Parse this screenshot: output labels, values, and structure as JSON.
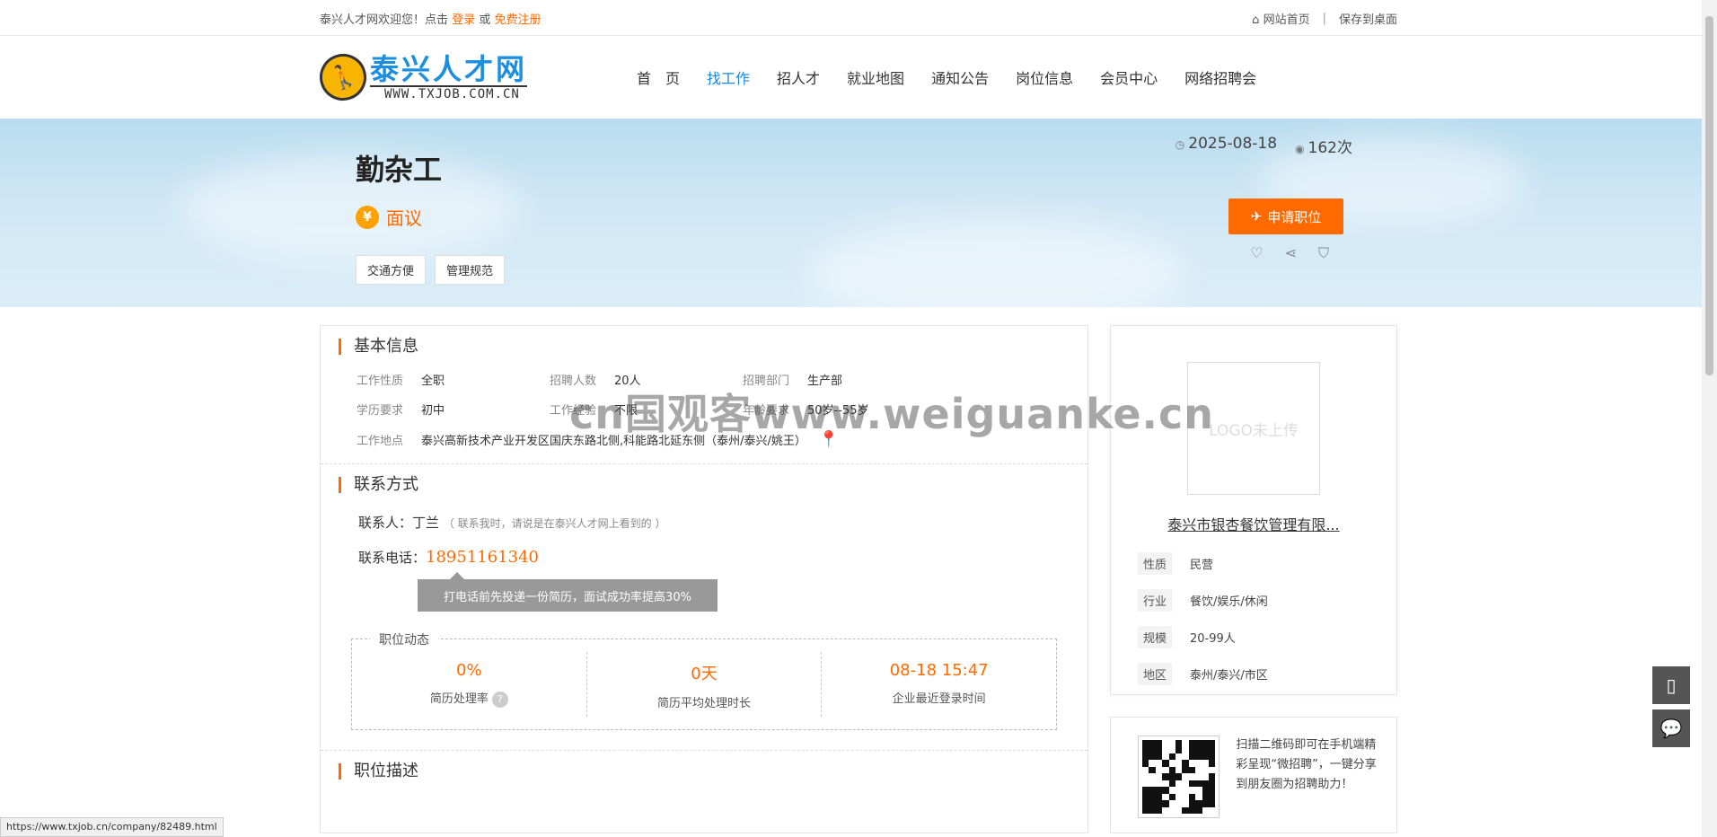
{
  "topbar": {
    "welcome": "泰兴人才网欢迎您！点击",
    "login": "登录",
    "or": "或",
    "register": "免费注册",
    "home": "网站首页",
    "separator": "|",
    "save_desktop": "保存到桌面"
  },
  "logo": {
    "title": "泰兴人才网",
    "url": "WWW.TXJOB.COM.CN"
  },
  "nav": [
    {
      "label": "首　页"
    },
    {
      "label": "找工作"
    },
    {
      "label": "招人才"
    },
    {
      "label": "就业地图"
    },
    {
      "label": "通知公告"
    },
    {
      "label": "岗位信息"
    },
    {
      "label": "会员中心"
    },
    {
      "label": "网络招聘会"
    }
  ],
  "job": {
    "title": "勤杂工",
    "salary_icon": "¥",
    "salary": "面议",
    "tags": [
      "交通方便",
      "管理规范"
    ],
    "date": "2025-08-18",
    "views": "162次",
    "apply": "申请职位"
  },
  "basic": {
    "title": "基本信息",
    "rows": [
      [
        {
          "label": "工作性质",
          "value": "全职"
        },
        {
          "label": "招聘人数",
          "value": "20人"
        },
        {
          "label": "招聘部门",
          "value": "生产部"
        }
      ],
      [
        {
          "label": "学历要求",
          "value": "初中"
        },
        {
          "label": "工作经验",
          "value": "不限"
        },
        {
          "label": "年龄要求",
          "value": "50岁--55岁"
        }
      ]
    ],
    "addr_label": "工作地点",
    "addr": "泰兴高新技术产业开发区国庆东路北侧,科能路北延东侧（泰州/泰兴/姚王）"
  },
  "contact": {
    "title": "联系方式",
    "person_label": "联系人：",
    "person": "丁兰",
    "hint": "（ 联系我时，请说是在泰兴人才网上看到的 ）",
    "phone_label": "联系电话：",
    "phone": "18951161340",
    "tooltip": "打电话前先投递一份简历，面试成功率提高30%"
  },
  "dynamic": {
    "title": "职位动态",
    "items": [
      {
        "value": "0%",
        "label": "简历处理率"
      },
      {
        "value": "0天",
        "label": "简历平均处理时长"
      },
      {
        "value": "08-18 15:47",
        "label": "企业最近登录时间"
      }
    ]
  },
  "desc_title": "职位描述",
  "company": {
    "logo_placeholder": "LOGO未上传",
    "name": "泰兴市银杏餐饮管理有限...",
    "rows": [
      {
        "key": "性质",
        "value": "民营"
      },
      {
        "key": "行业",
        "value": "餐饮/娱乐/休闲"
      },
      {
        "key": "规模",
        "value": "20-99人"
      },
      {
        "key": "地区",
        "value": "泰州/泰兴/市区"
      }
    ]
  },
  "qr": {
    "text": "扫描二维码即可在手机端精彩呈现“微招聘”，一键分享到朋友圈为招聘助力！"
  },
  "watermark": "cn国观客www.weiguanke.cn",
  "statusbar": "https://www.txjob.cn/company/82489.html",
  "icons": {
    "home": "home-icon",
    "clock": "clock-icon",
    "eye": "eye-icon",
    "send": "paper-plane-icon",
    "heart": "heart-icon",
    "share": "share-icon",
    "report": "shield-icon",
    "pin": "map-pin-icon",
    "mobile": "mobile-icon",
    "chat": "chat-icon"
  },
  "colors": {
    "accent": "#ff6a00",
    "nav_active": "#1787e0",
    "logo_blue": "#1d8fe0"
  }
}
